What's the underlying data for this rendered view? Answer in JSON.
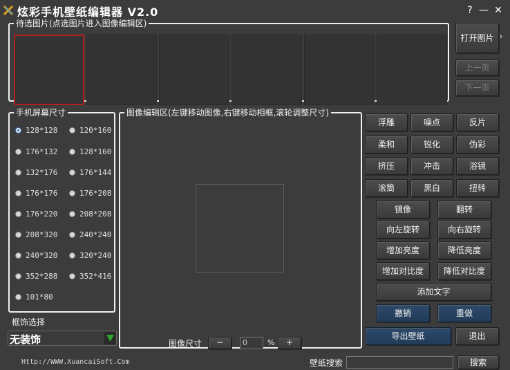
{
  "app": {
    "title": "炫彩手机壁纸编辑器 V2.0"
  },
  "window": {
    "help_label": "?",
    "minimize_label": "—",
    "close_label": "✕"
  },
  "pending": {
    "legend": "待选图片(点选图片进入图像编辑区)"
  },
  "right_top": {
    "open_label": "打开图片",
    "prev_label": "上一页",
    "next_label": "下一页",
    "chevron": "›"
  },
  "screen_size": {
    "legend": "手机屏幕尺寸",
    "options": [
      "128*128",
      "120*160",
      "176*132",
      "128*160",
      "132*176",
      "176*144",
      "176*176",
      "176*208",
      "176*220",
      "208*208",
      "208*320",
      "240*240",
      "240*320",
      "320*240",
      "352*288",
      "352*416",
      "101*80"
    ],
    "selected": "128*128"
  },
  "frame": {
    "label": "框饰选择",
    "value": "无装饰"
  },
  "editor": {
    "legend": "图像编辑区(左键移动图像,右键移动相框,滚轮调整尺寸)",
    "size_label": "图像尺寸",
    "minus": "−",
    "value": "0",
    "percent": "%",
    "plus": "+"
  },
  "effects": {
    "row1": [
      "浮雕",
      "噪点",
      "反片"
    ],
    "row2": [
      "柔和",
      "锐化",
      "伪彩"
    ],
    "row3": [
      "挤压",
      "冲击",
      "浴镜"
    ],
    "row4": [
      "滚筒",
      "黑白",
      "扭转"
    ],
    "mirror": "镜像",
    "flip": "翻转",
    "rot_left": "向左旋转",
    "rot_right": "向右旋转",
    "bright_up": "增加亮度",
    "bright_down": "降低亮度",
    "contrast_up": "增加对比度",
    "contrast_down": "降低对比度",
    "add_text": "添加文字",
    "undo": "撤销",
    "redo": "重做",
    "export": "导出壁纸",
    "exit": "退出"
  },
  "footer": {
    "url": "Http://WWW.XuancaiSoft.Com",
    "search_label": "壁纸搜索",
    "search_value": "",
    "search_button": "搜索"
  },
  "colors": {
    "background": "#3c3c3c",
    "selected_thumb_border": "#b02020",
    "blue_button": "#2e4a6a",
    "combo_arrow": "#2ea82e"
  }
}
